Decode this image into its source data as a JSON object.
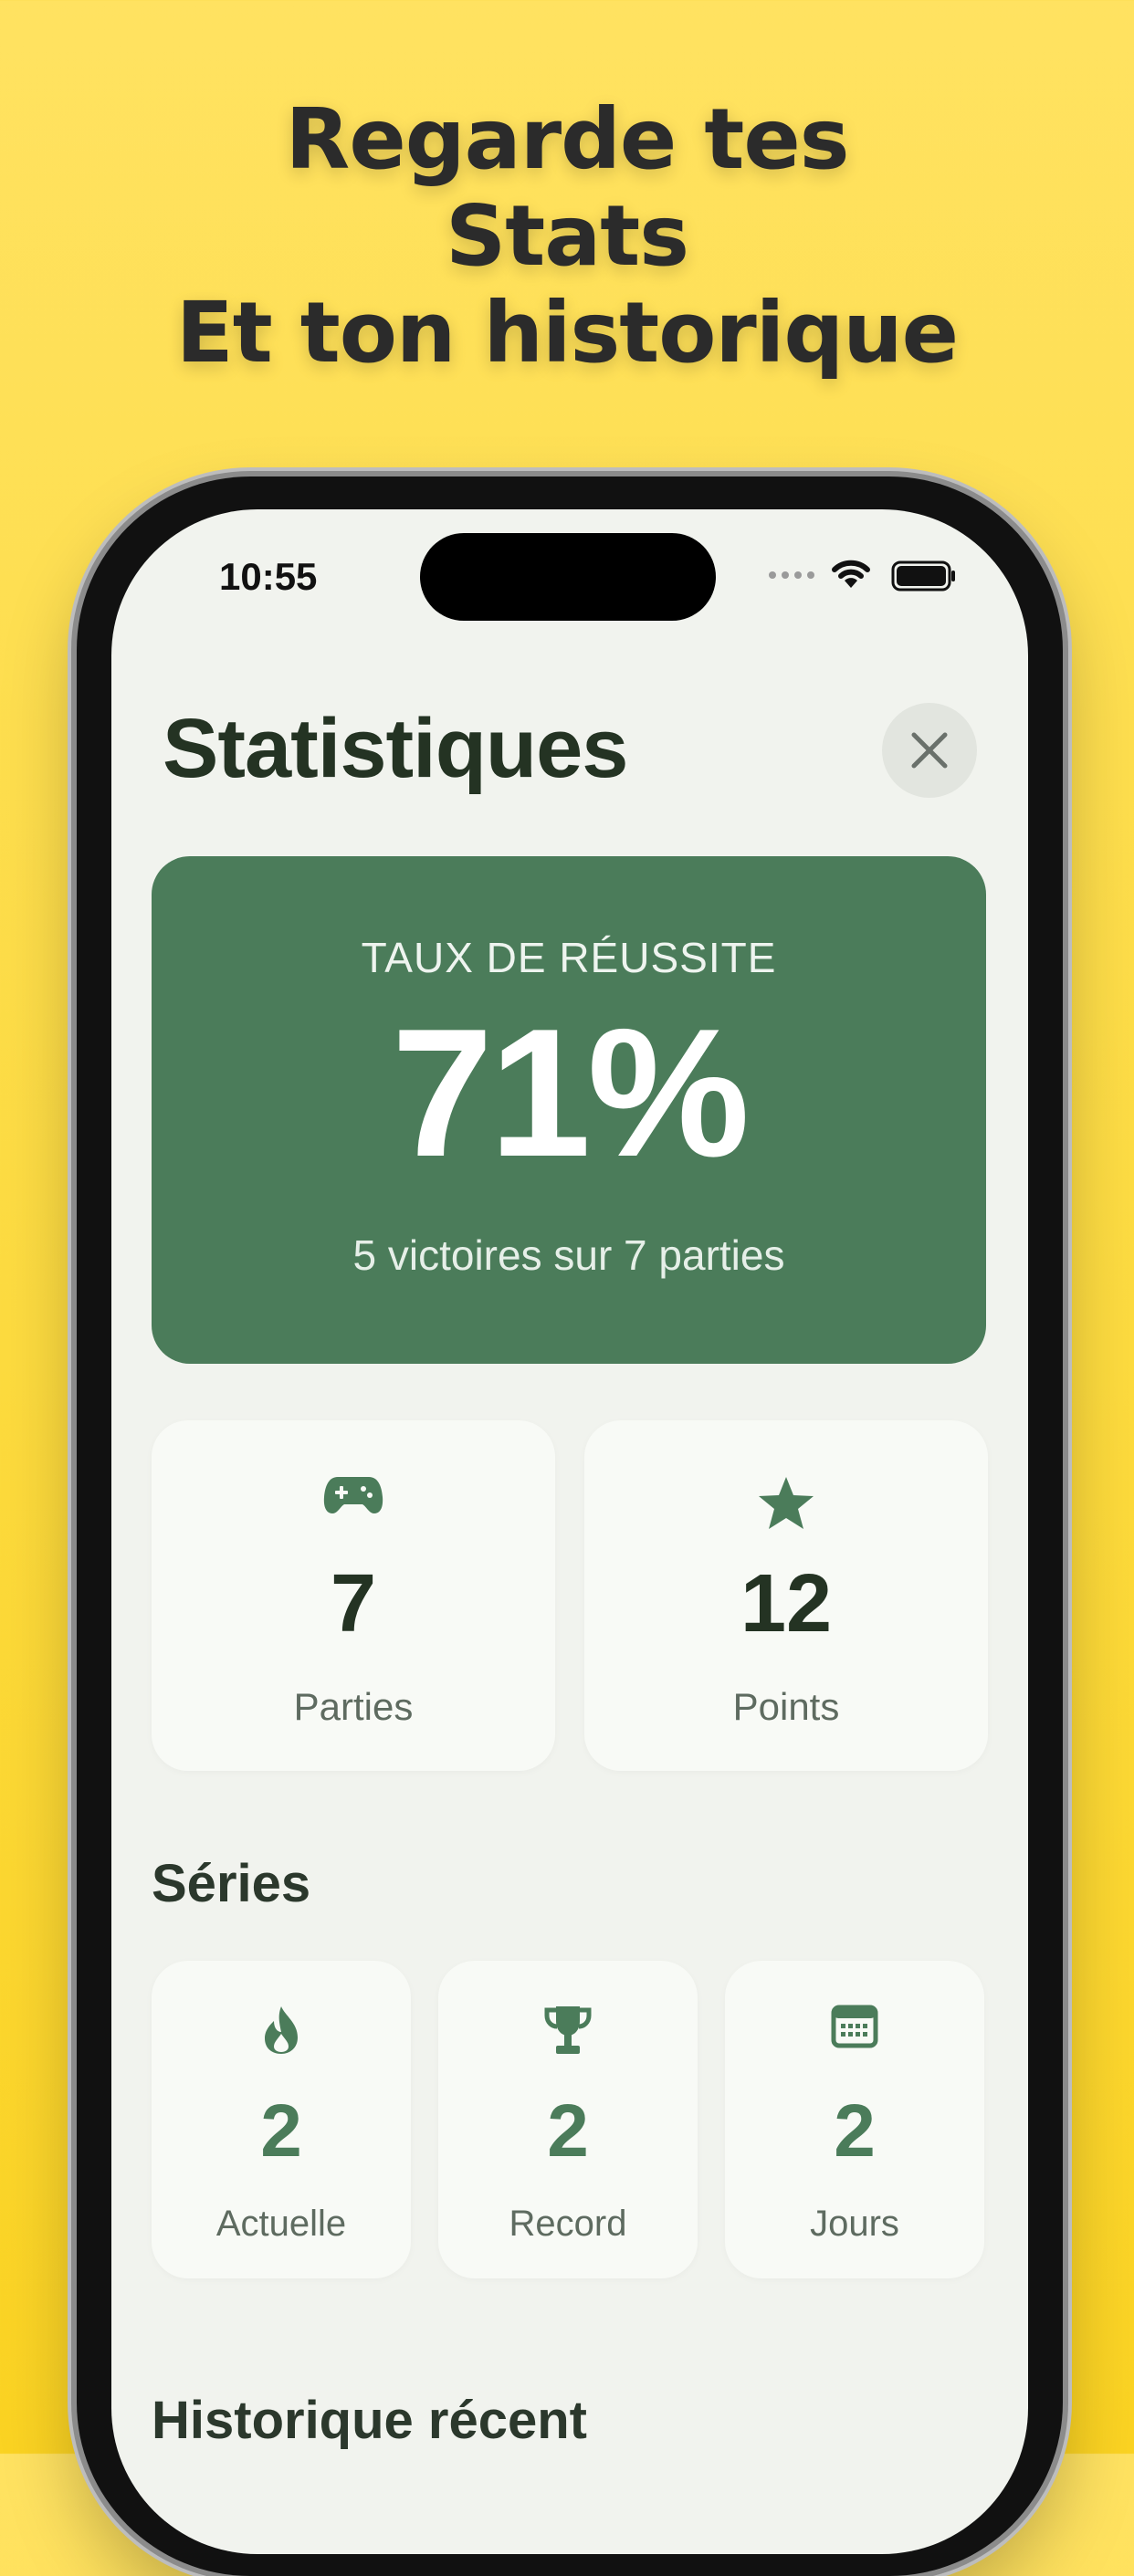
{
  "headline": [
    "Regarde tes",
    "Stats",
    "Et ton historique"
  ],
  "status": {
    "time": "10:55"
  },
  "page": {
    "title": "Statistiques"
  },
  "success": {
    "label": "TAUX DE RÉUSSITE",
    "value": "71%",
    "subtitle": "5 victoires sur 7 parties"
  },
  "totals": [
    {
      "icon": "gamepad-icon",
      "value": "7",
      "label": "Parties"
    },
    {
      "icon": "star-icon",
      "value": "12",
      "label": "Points"
    }
  ],
  "streaks": {
    "title": "Séries",
    "items": [
      {
        "icon": "flame-icon",
        "value": "2",
        "label": "Actuelle"
      },
      {
        "icon": "trophy-icon",
        "value": "2",
        "label": "Record"
      },
      {
        "icon": "calendar-icon",
        "value": "2",
        "label": "Jours"
      }
    ]
  },
  "history": {
    "title": "Historique récent"
  },
  "colors": {
    "accent": "#4B7C5A",
    "background": "#F1F3EE",
    "promo": "#FDDB3F"
  }
}
